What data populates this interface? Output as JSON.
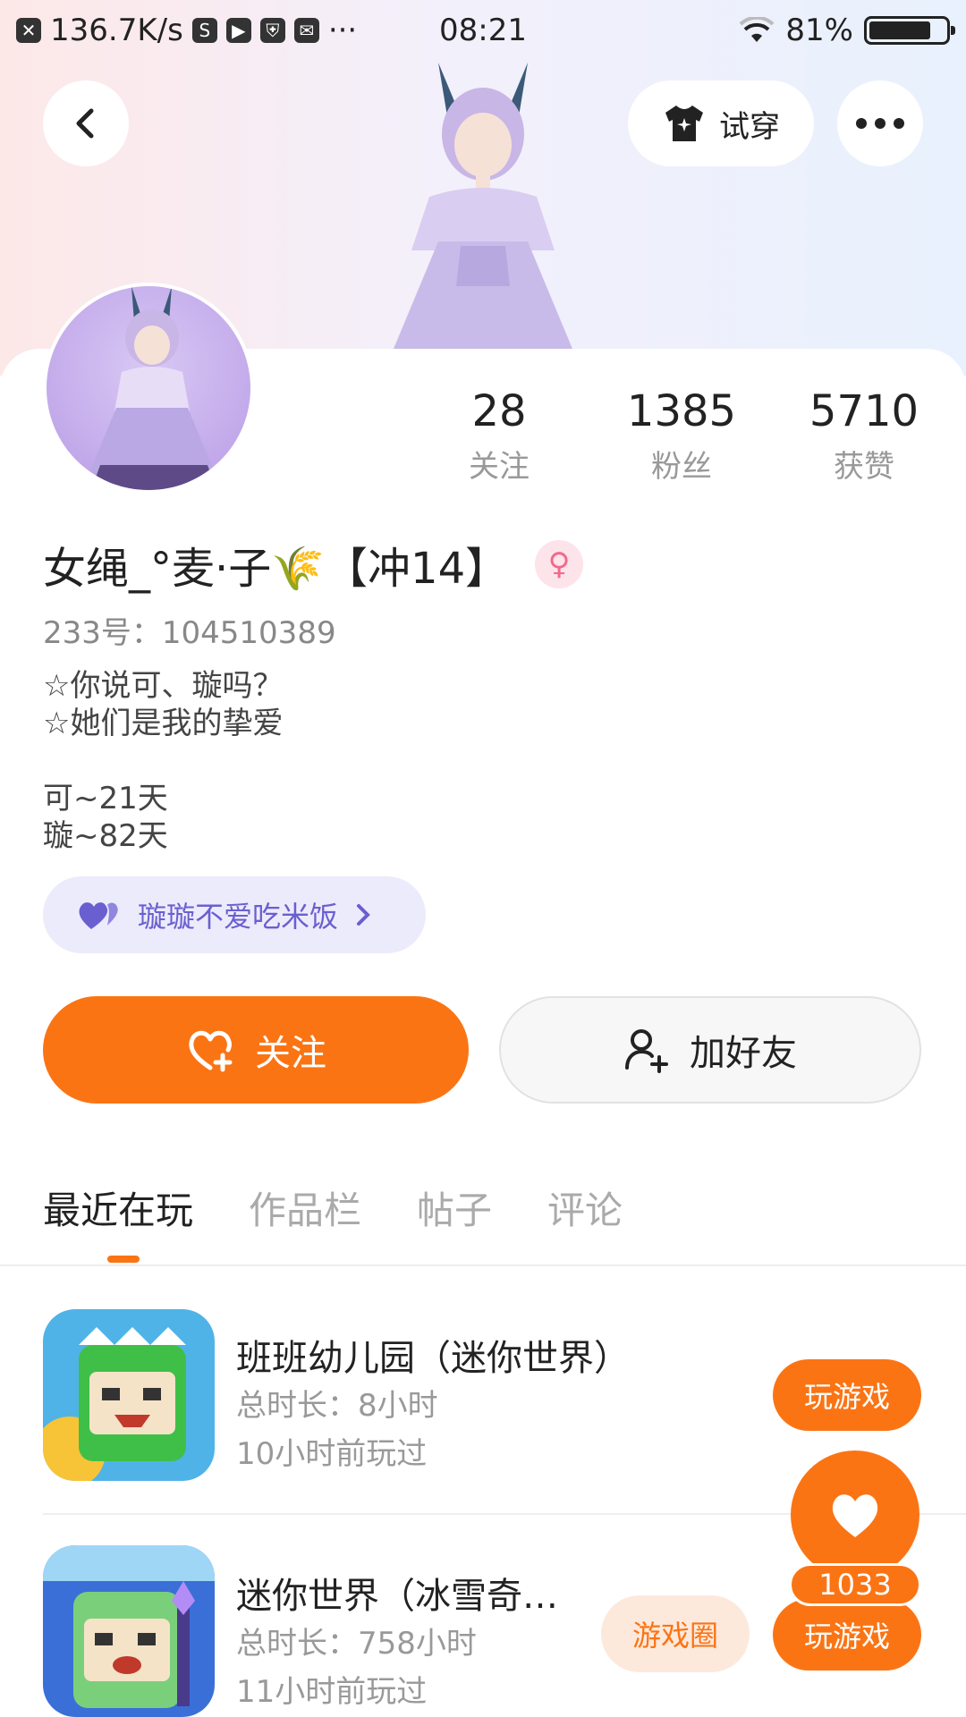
{
  "status_bar": {
    "speed": "136.7K/s",
    "time": "08:21",
    "battery": "81%",
    "battery_level": 0.81
  },
  "header": {
    "back_icon": "back-arrow-icon",
    "try_on_label": "试穿",
    "more_icon": "more-dots-icon"
  },
  "profile": {
    "stats": [
      {
        "value": "28",
        "label": "关注"
      },
      {
        "value": "1385",
        "label": "粉丝"
      },
      {
        "value": "5710",
        "label": "获赞"
      }
    ],
    "name": "女绳_°麦·子🌾【冲14】",
    "gender_icon": "female-icon",
    "id_line": "233号：104510389",
    "bio_lines": [
      "☆你说可、璇吗？",
      "☆她们是我的挚爱",
      "可~21天",
      "璇~82天"
    ],
    "cp_label": "璇璇不爱吃米饭",
    "follow_label": "关注",
    "add_friend_label": "加好友"
  },
  "tabs": [
    {
      "label": "最近在玩",
      "active": true
    },
    {
      "label": "作品栏",
      "active": false
    },
    {
      "label": "帖子",
      "active": false
    },
    {
      "label": "评论",
      "active": false
    }
  ],
  "games": [
    {
      "title": "班班幼儿园（迷你世界）",
      "duration": "总时长：8小时",
      "last_played": "10小时前玩过",
      "play_label": "玩游戏"
    },
    {
      "title": "迷你世界（冰雪奇…",
      "duration": "总时长：758小时",
      "last_played": "11小时前玩过",
      "circle_label": "游戏圈",
      "play_label": "玩游戏"
    }
  ],
  "fab": {
    "icon": "heart-icon",
    "count": "1033"
  },
  "colors": {
    "accent": "#fb7414",
    "cp_purple": "#6a5fd0"
  }
}
